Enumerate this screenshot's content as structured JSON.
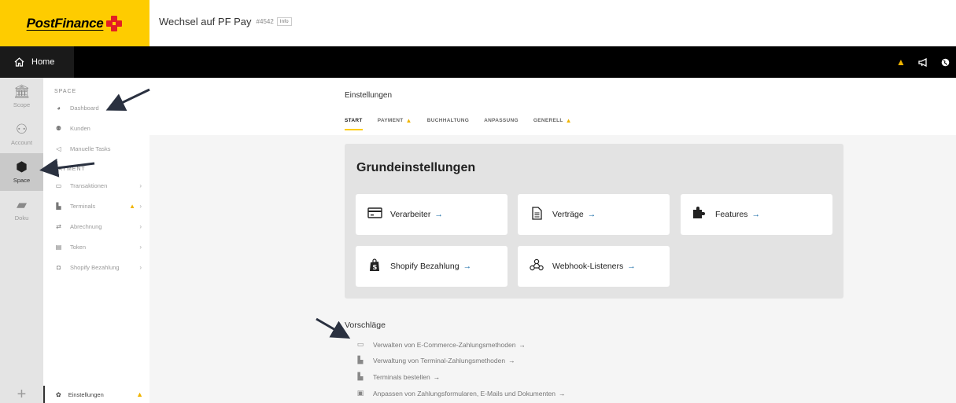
{
  "header": {
    "logo_text": "PostFinance",
    "space_name": "Wechsel auf PF Pay",
    "space_id": "#4542",
    "info_label": "Info"
  },
  "navbar": {
    "home_label": "Home",
    "icons": [
      "warning-icon",
      "megaphone-icon",
      "globe-icon"
    ]
  },
  "rail": {
    "items": [
      {
        "label": "Scope",
        "icon": "bank-icon"
      },
      {
        "label": "Account",
        "icon": "users-icon"
      },
      {
        "label": "Space",
        "icon": "cube-icon",
        "active": true
      },
      {
        "label": "Doku",
        "icon": "book-icon"
      }
    ]
  },
  "subnav": {
    "space_heading": "SPACE",
    "space_items": [
      {
        "label": "Dashboard",
        "icon": "dashboard-icon"
      },
      {
        "label": "Kunden",
        "icon": "customers-icon"
      },
      {
        "label": "Manuelle Tasks",
        "icon": "megaphone-icon"
      }
    ],
    "payment_heading": "PAYMENT",
    "payment_items": [
      {
        "label": "Transaktionen",
        "icon": "card-icon"
      },
      {
        "label": "Terminals",
        "icon": "terminal-icon",
        "warning": true
      },
      {
        "label": "Abrechnung",
        "icon": "transfer-icon"
      },
      {
        "label": "Token",
        "icon": "token-icon"
      },
      {
        "label": "Shopify Bezahlung",
        "icon": "shopify-icon"
      }
    ],
    "bottom_label": "Einstellungen"
  },
  "main": {
    "page_title": "Einstellungen",
    "tabs": [
      {
        "label": "START",
        "active": true
      },
      {
        "label": "PAYMENT",
        "warning": true
      },
      {
        "label": "BUCHHALTUNG"
      },
      {
        "label": "ANPASSUNG"
      },
      {
        "label": "GENERELL",
        "warning": true
      }
    ],
    "panel_title": "Grundeinstellungen",
    "cards": [
      {
        "label": "Verarbeiter",
        "icon": "card-icon"
      },
      {
        "label": "Verträge",
        "icon": "document-icon"
      },
      {
        "label": "Features",
        "icon": "puzzle-icon"
      },
      {
        "label": "Shopify Bezahlung",
        "icon": "shopify-icon"
      },
      {
        "label": "Webhook-Listeners",
        "icon": "webhook-icon"
      }
    ],
    "arrow_glyph": "→",
    "suggestions_title": "Vorschläge",
    "suggestions": [
      {
        "label": "Verwalten von E-Commerce-Zahlungsmethoden",
        "icon": "card-icon"
      },
      {
        "label": "Verwaltung von Terminal-Zahlungsmethoden",
        "icon": "terminal-icon"
      },
      {
        "label": "Terminals bestellen",
        "icon": "terminal-icon"
      },
      {
        "label": "Anpassen von Zahlungsformularen, E-Mails und Dokumenten",
        "icon": "image-icon"
      }
    ]
  },
  "colors": {
    "brand_yellow": "#fecc00",
    "brand_red": "#e31e24",
    "warning": "#f0b400",
    "link_arrow": "#1b6ea8"
  }
}
